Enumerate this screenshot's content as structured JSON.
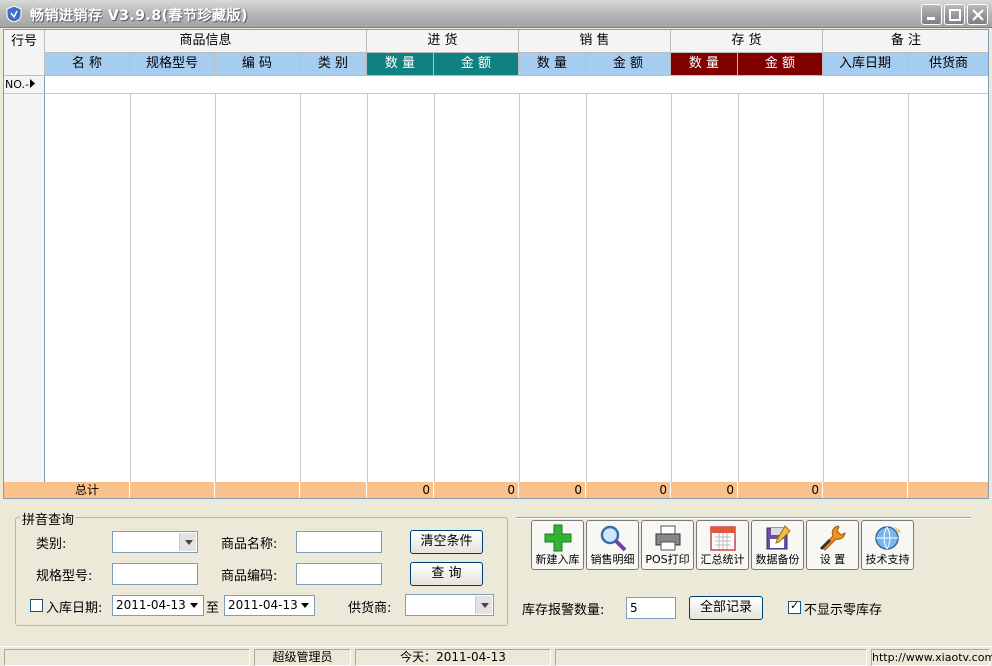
{
  "window": {
    "title": "畅销进销存 V3.9.8(春节珍藏版)"
  },
  "grid": {
    "row_header": "行号",
    "groups": [
      "商品信息",
      "进 货",
      "销 售",
      "存 货",
      "备 注"
    ],
    "columns": [
      "名 称",
      "规格型号",
      "编 码",
      "类 别",
      "数 量",
      "金 额",
      "数 量",
      "金 额",
      "数 量",
      "金 额",
      "入库日期",
      "供货商"
    ],
    "first_row_label": "NO.-",
    "total_label": "总计",
    "totals": [
      "0",
      "0",
      "0",
      "0",
      "0",
      "0"
    ],
    "colors": {
      "header_blue": "#a6cdf0",
      "teal": "#118080",
      "dark_red": "#800000",
      "total_row": "#fbc18b"
    }
  },
  "query": {
    "title": "拼音查询",
    "category_label": "类别:",
    "name_label": "商品名称:",
    "spec_label": "规格型号:",
    "code_label": "商品编码:",
    "date_label": "入库日期:",
    "date_from": "2011-04-13",
    "date_to_sep": "至",
    "date_to": "2011-04-13",
    "supplier_label": "供货商:",
    "clear_button": "清空条件",
    "search_button": "查 询"
  },
  "toolbar": {
    "buttons": [
      {
        "label": "新建入库",
        "icon": "plus-icon"
      },
      {
        "label": "销售明细",
        "icon": "magnifier-icon"
      },
      {
        "label": "POS打印",
        "icon": "printer-icon"
      },
      {
        "label": "汇总统计",
        "icon": "calendar-icon"
      },
      {
        "label": "数据备份",
        "icon": "disk-icon"
      },
      {
        "label": "设 置",
        "icon": "wrench-icon"
      },
      {
        "label": "技术支持",
        "icon": "globe-icon"
      }
    ]
  },
  "stock": {
    "warn_label": "库存报警数量:",
    "warn_value": "5",
    "all_records_button": "全部记录",
    "hide_zero_label": "不显示零库存"
  },
  "status": {
    "user": "超级管理员",
    "today": "今天：2011-04-13",
    "url": "http://www.xiaotv.com"
  }
}
